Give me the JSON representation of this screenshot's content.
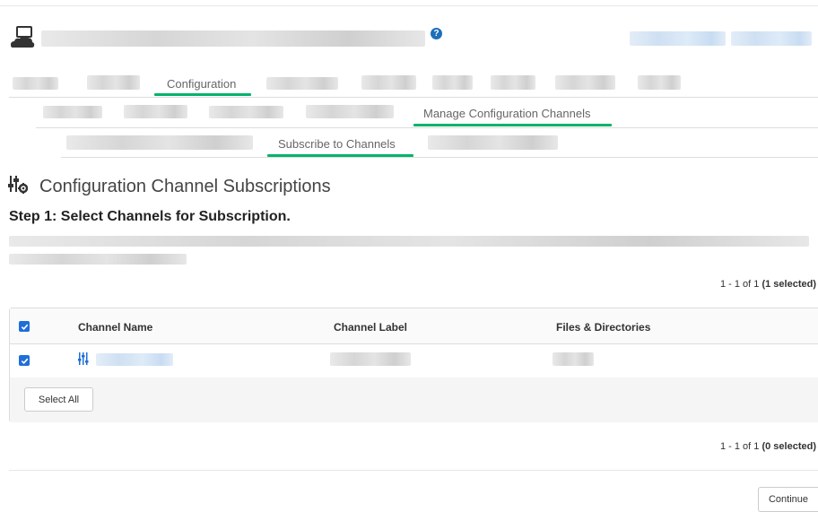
{
  "icons": {
    "system": "system-computer-icon",
    "help": "help-icon",
    "config_channel": "config-channel-icon",
    "checkbox": "checkbox-checked-icon"
  },
  "colors": {
    "accent_underline": "#00b36b",
    "checkbox": "#1e6fd9",
    "help_icon": "#1c6fb8",
    "channel_icon": "#1e6fd9"
  },
  "header": {
    "help_glyph": "?"
  },
  "nav": {
    "primary_active": "Configuration",
    "secondary_active": "Manage Configuration Channels",
    "tertiary_active": "Subscribe to Channels"
  },
  "page": {
    "title": "Configuration Channel Subscriptions",
    "step_title": "Step 1: Select Channels for Subscription."
  },
  "pagination_top": {
    "range": "1 - 1 of 1",
    "selected": "(1 selected)"
  },
  "table": {
    "columns": [
      "Channel Name",
      "Channel Label",
      "Files & Directories"
    ],
    "rows": [
      {
        "checked": true
      }
    ],
    "header_checked": true,
    "select_all_label": "Select All"
  },
  "pagination_bottom": {
    "range": "1 - 1 of 1",
    "selected": "(0 selected)"
  },
  "actions": {
    "continue_label": "Continue"
  }
}
